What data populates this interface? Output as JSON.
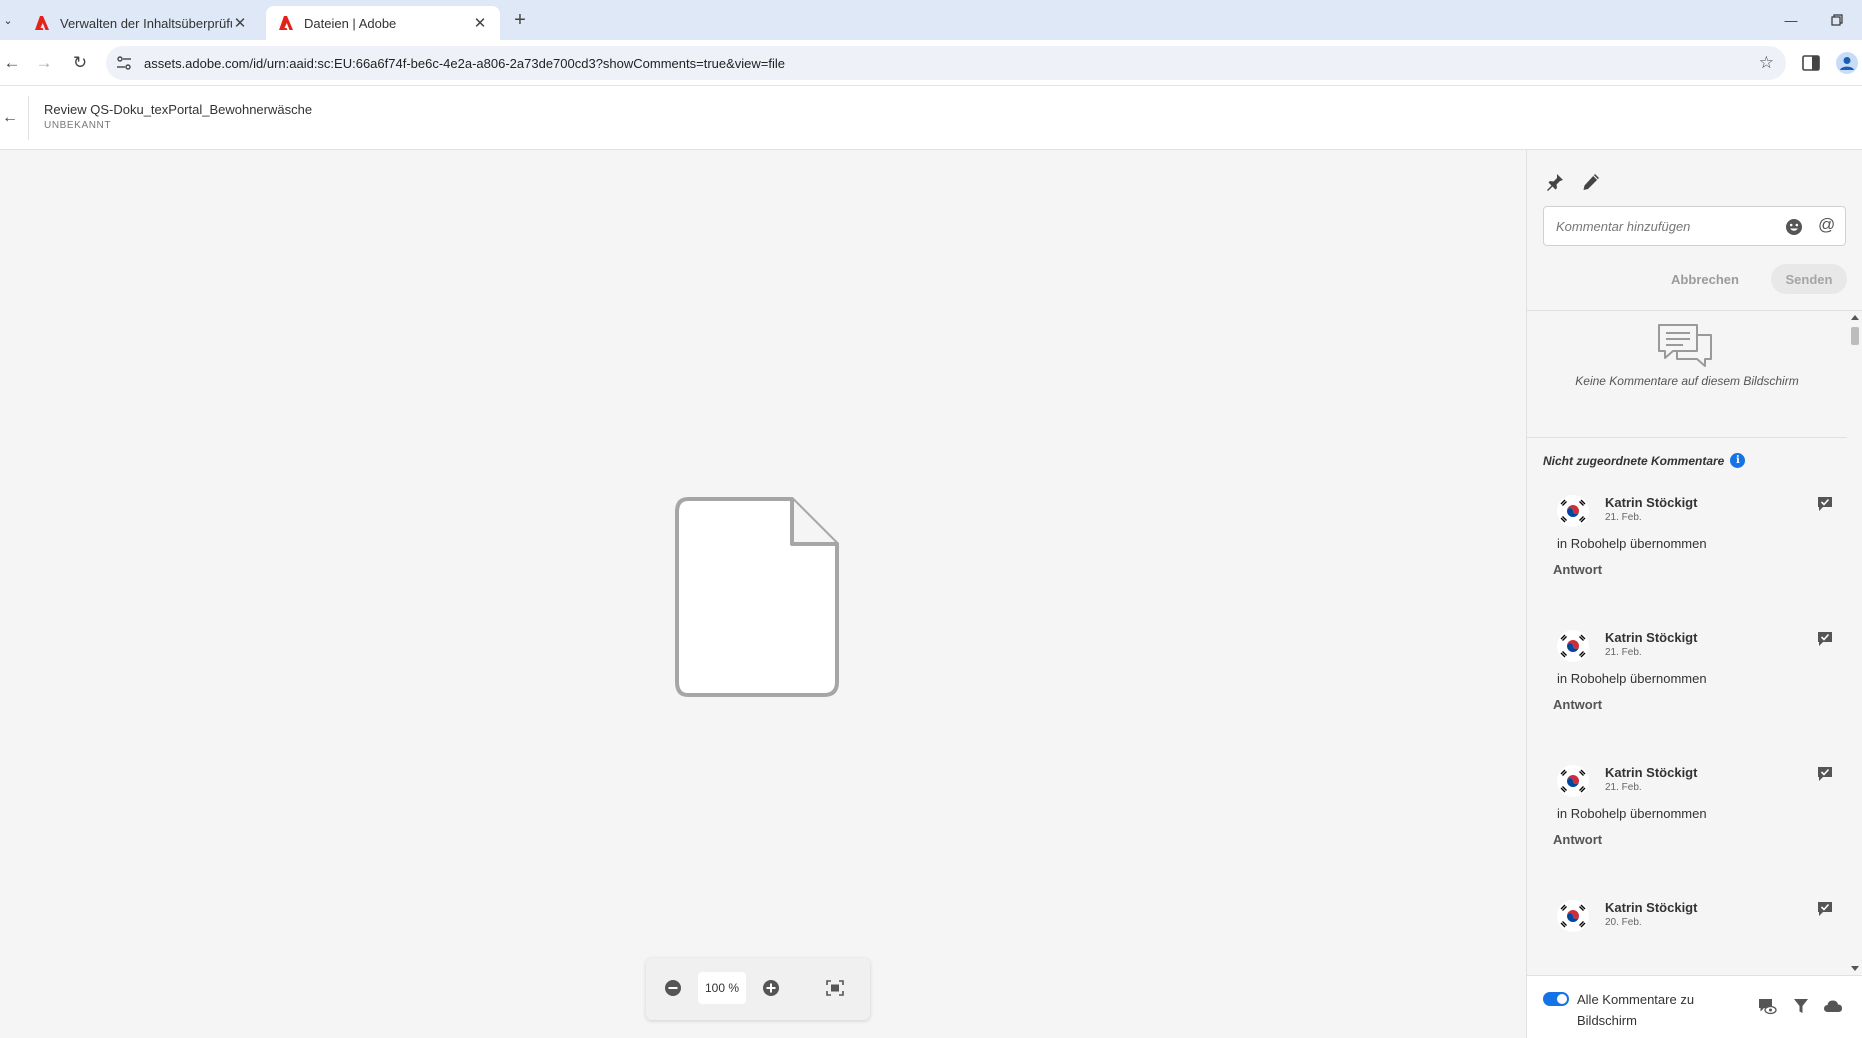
{
  "browser": {
    "tabs": [
      {
        "title": "Verwalten der Inhaltsüberprüfung",
        "active": false
      },
      {
        "title": "Dateien | Adobe",
        "active": true
      }
    ],
    "url": "assets.adobe.com/id/urn:aaid:sc:EU:66a6f74f-be6c-4e2a-a806-2a73de700cd3?showComments=true&view=file"
  },
  "header": {
    "title": "Review QS-Doku_texPortal_Bewohnerwäsche",
    "subtitle": "UNBEKANNT"
  },
  "viewer": {
    "zoom": "100 %"
  },
  "comments_panel": {
    "input_placeholder": "Kommentar hinzufügen",
    "cancel_label": "Abbrechen",
    "send_label": "Senden",
    "empty_text": "Keine Kommentare auf diesem Bildschirm",
    "unassigned_title": "Nicht zugeordnete Kommentare",
    "comments": [
      {
        "author": "Katrin Stöckigt",
        "date": "21. Feb.",
        "text": "in Robohelp übernommen",
        "reply": "Antwort"
      },
      {
        "author": "Katrin Stöckigt",
        "date": "21. Feb.",
        "text": "in Robohelp übernommen",
        "reply": "Antwort"
      },
      {
        "author": "Katrin Stöckigt",
        "date": "21. Feb.",
        "text": "in Robohelp übernommen",
        "reply": "Antwort"
      },
      {
        "author": "Katrin Stöckigt",
        "date": "20. Feb.",
        "text": "",
        "reply": ""
      }
    ],
    "footer_toggle_label": "Alle Kommentare zu Bildschirm",
    "footer_toggle_on": true
  },
  "colors": {
    "accent": "#1473e6",
    "adobe_red": "#e2231a"
  }
}
